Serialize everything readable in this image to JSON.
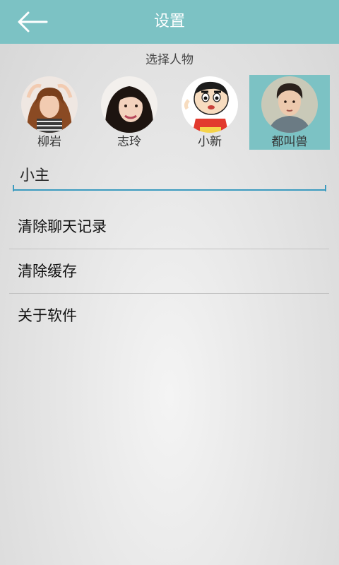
{
  "header": {
    "title": "设置",
    "back_icon": "arrow-left-icon",
    "color": "#7cc2c4"
  },
  "character_section": {
    "title": "选择人物",
    "items": [
      {
        "name": "柳岩",
        "selected": false
      },
      {
        "name": "志玲",
        "selected": false
      },
      {
        "name": "小新",
        "selected": false
      },
      {
        "name": "都叫兽",
        "selected": true
      }
    ]
  },
  "name_field": {
    "value": "小主"
  },
  "menu": {
    "items": [
      {
        "label": "清除聊天记录"
      },
      {
        "label": "清除缓存"
      },
      {
        "label": "关于软件"
      }
    ]
  }
}
